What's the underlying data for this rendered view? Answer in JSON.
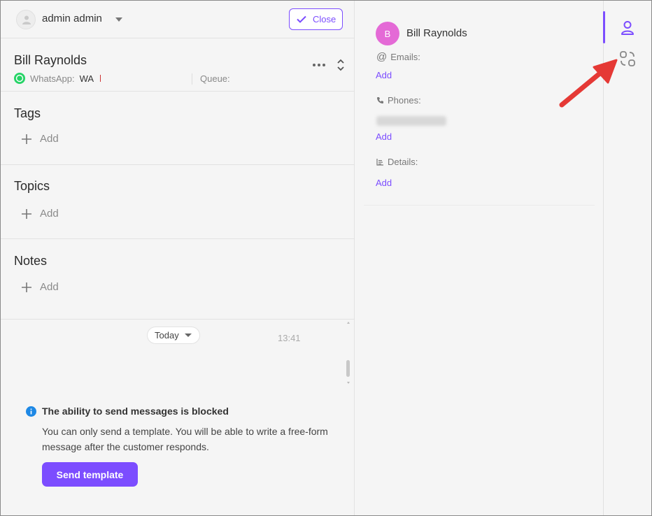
{
  "topbar": {
    "user_name": "admin admin",
    "close_label": "Close"
  },
  "contact": {
    "name": "Bill Raynolds",
    "channel_label": "WhatsApp:",
    "channel_value": "WA",
    "queue_label": "Queue:"
  },
  "sections": {
    "tags_title": "Tags",
    "topics_title": "Topics",
    "notes_title": "Notes",
    "add_label": "Add"
  },
  "chat": {
    "date_pill": "Today",
    "time": "13:41",
    "blocked_title": "The ability to send messages is blocked",
    "blocked_text": "You can only send a template. You will be able to write a free-form message after the customer responds.",
    "send_template_label": "Send template"
  },
  "card": {
    "avatar_letter": "B",
    "name": "Bill Raynolds",
    "emails_label": "Emails:",
    "phones_label": "Phones:",
    "details_label": "Details:",
    "add_label": "Add"
  },
  "colors": {
    "accent": "#7c4dff",
    "avatar": "#e46ad6",
    "whatsapp": "#25d366",
    "info": "#1e88e5",
    "annotation_arrow": "#e53935"
  }
}
